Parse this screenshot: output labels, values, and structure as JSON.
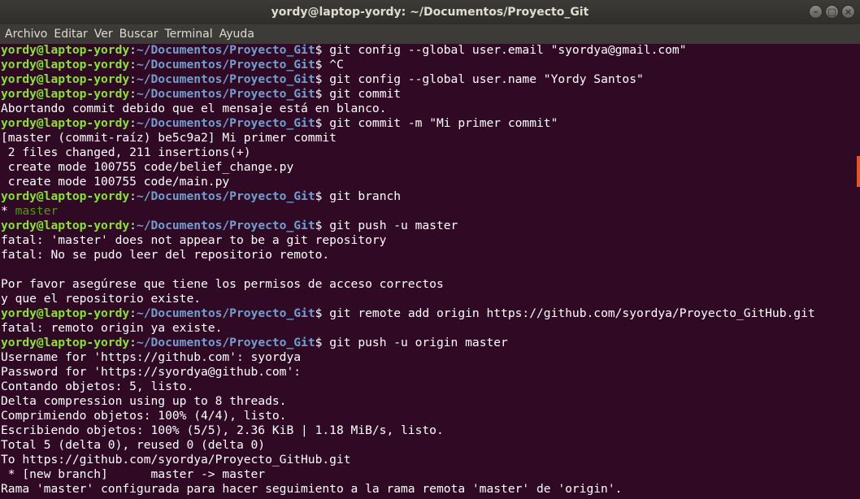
{
  "window": {
    "title": "yordy@laptop-yordy: ~/Documentos/Proyecto_Git",
    "controls": [
      "–",
      "□",
      "×"
    ]
  },
  "menu": [
    "Archivo",
    "Editar",
    "Ver",
    "Buscar",
    "Terminal",
    "Ayuda"
  ],
  "prompt": {
    "user": "yordy@laptop-yordy",
    "sep": ":",
    "path": "~/Documentos/Proyecto_Git",
    "symbol": "$"
  },
  "colors": {
    "background": "#300a24",
    "user": "#8ae234",
    "path": "#729fcf",
    "branch": "#4e9a06",
    "scrollbar": "#e95420"
  },
  "lines": [
    {
      "type": "cmd",
      "text": " git config --global user.email \"syordya@gmail.com\""
    },
    {
      "type": "cmd",
      "text": " ^C"
    },
    {
      "type": "cmd",
      "text": " git config --global user.name \"Yordy Santos\""
    },
    {
      "type": "cmd",
      "text": " git commit"
    },
    {
      "type": "out",
      "text": "Abortando commit debido que el mensaje está en blanco."
    },
    {
      "type": "cmd",
      "text": " git commit -m \"Mi primer commit\""
    },
    {
      "type": "out",
      "text": "[master (commit-raíz) be5c9a2] Mi primer commit"
    },
    {
      "type": "out",
      "text": " 2 files changed, 211 insertions(+)"
    },
    {
      "type": "out",
      "text": " create mode 100755 code/belief_change.py"
    },
    {
      "type": "out",
      "text": " create mode 100755 code/main.py"
    },
    {
      "type": "cmd",
      "text": " git branch"
    },
    {
      "type": "branch",
      "star": "* ",
      "text": "master"
    },
    {
      "type": "cmd",
      "text": " git push -u master"
    },
    {
      "type": "out",
      "text": "fatal: 'master' does not appear to be a git repository"
    },
    {
      "type": "out",
      "text": "fatal: No se pudo leer del repositorio remoto."
    },
    {
      "type": "out",
      "text": ""
    },
    {
      "type": "out",
      "text": "Por favor asegúrese que tiene los permisos de acceso correctos"
    },
    {
      "type": "out",
      "text": "y que el repositorio existe."
    },
    {
      "type": "cmd",
      "text": " git remote add origin https://github.com/syordya/Proyecto_GitHub.git"
    },
    {
      "type": "out",
      "text": "fatal: remoto origin ya existe."
    },
    {
      "type": "cmd",
      "text": " git push -u origin master"
    },
    {
      "type": "out",
      "text": "Username for 'https://github.com': syordya"
    },
    {
      "type": "out",
      "text": "Password for 'https://syordya@github.com':"
    },
    {
      "type": "out",
      "text": "Contando objetos: 5, listo."
    },
    {
      "type": "out",
      "text": "Delta compression using up to 8 threads."
    },
    {
      "type": "out",
      "text": "Comprimiendo objetos: 100% (4/4), listo."
    },
    {
      "type": "out",
      "text": "Escribiendo objetos: 100% (5/5), 2.36 KiB | 1.18 MiB/s, listo."
    },
    {
      "type": "out",
      "text": "Total 5 (delta 0), reused 0 (delta 0)"
    },
    {
      "type": "out",
      "text": "To https://github.com/syordya/Proyecto_GitHub.git"
    },
    {
      "type": "out",
      "text": " * [new branch]      master -> master"
    },
    {
      "type": "out",
      "text": "Rama 'master' configurada para hacer seguimiento a la rama remota 'master' de 'origin'."
    }
  ]
}
